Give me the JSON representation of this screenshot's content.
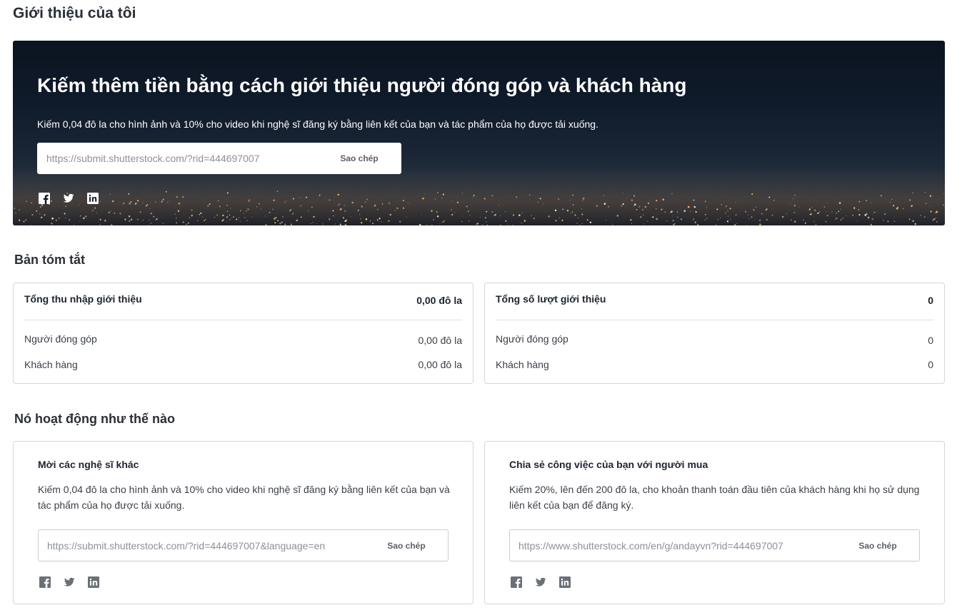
{
  "page_title": "Giới thiệu của tôi",
  "hero": {
    "title": "Kiếm thêm tiền bằng cách giới thiệu người đóng góp và khách hàng",
    "description": "Kiếm 0,04 đô la cho hình ảnh và 10% cho video khi nghệ sĩ đăng ký bằng liên kết của bạn và tác phẩm của họ được tải xuống.",
    "link": "https://submit.shutterstock.com/?rid=444697007",
    "copy_label": "Sao chép",
    "socials": [
      "facebook-icon",
      "twitter-icon",
      "linkedin-icon"
    ]
  },
  "summary": {
    "title": "Bản tóm tắt",
    "earnings": {
      "label": "Tổng thu nhập giới thiệu",
      "value": "0,00 đô la",
      "rows": [
        {
          "label": "Người đóng góp",
          "value": "0,00 đô la"
        },
        {
          "label": "Khách hàng",
          "value": "0,00 đô la"
        }
      ]
    },
    "referrals": {
      "label": "Tổng số lượt giới thiệu",
      "value": "0",
      "rows": [
        {
          "label": "Người đóng góp",
          "value": "0"
        },
        {
          "label": "Khách hàng",
          "value": "0"
        }
      ]
    }
  },
  "how": {
    "title": "Nó hoạt động như thế nào",
    "artists": {
      "title": "Mời các nghệ sĩ khác",
      "description": "Kiếm 0,04 đô la cho hình ảnh và 10% cho video khi nghệ sĩ đăng ký bằng liên kết của bạn và tác phẩm của họ được tải xuống.",
      "link": "https://submit.shutterstock.com/?rid=444697007&language=en",
      "copy_label": "Sao chép"
    },
    "buyers": {
      "title": "Chia sẻ công việc của bạn với người mua",
      "description": "Kiếm 20%, lên đến 200 đô la, cho khoản thanh toán đầu tiên của khách hàng khi họ sử dụng liên kết của bạn để đăng ký.",
      "link": "https://www.shutterstock.com/en/g/andayvn?rid=444697007",
      "copy_label": "Sao chép"
    }
  },
  "colors": {
    "text_dark": "#1e2330",
    "border": "#d3d6db",
    "icon_gray": "#6b7078",
    "hero_dark": "#0b1420"
  }
}
